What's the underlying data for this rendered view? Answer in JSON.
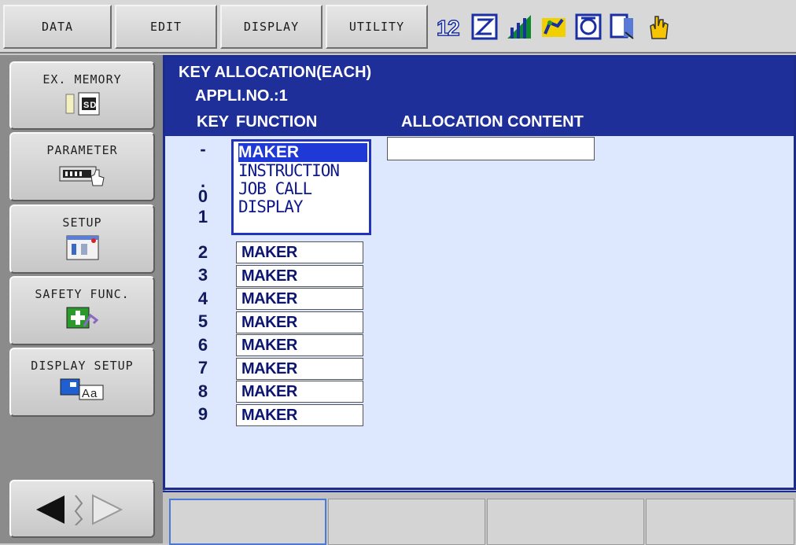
{
  "menu_bar": {
    "items": [
      {
        "label": "DATA"
      },
      {
        "label": "EDIT"
      },
      {
        "label": "DISPLAY"
      },
      {
        "label": "UTILITY"
      }
    ],
    "status_icons": [
      "numbers-12-icon",
      "edit-mode-icon",
      "signal-icon",
      "robot-arm-icon",
      "cycle-icon",
      "job-icon",
      "hand-icon"
    ]
  },
  "main_menu": {
    "items": [
      {
        "label": "EX. MEMORY",
        "icon": "sd-card-icon"
      },
      {
        "label": "PARAMETER",
        "icon": "parameter-icon"
      },
      {
        "label": "SETUP",
        "icon": "setup-icon"
      },
      {
        "label": "SAFETY FUNC.",
        "icon": "safety-icon"
      },
      {
        "label": "DISPLAY SETUP",
        "icon": "display-setup-icon"
      }
    ],
    "nav": [
      "arrow-left-icon",
      "divider-icon",
      "arrow-right-icon"
    ]
  },
  "screen": {
    "title": "KEY ALLOCATION(EACH)",
    "appli_no": "APPLI.NO.:1",
    "col_key": "KEY",
    "col_function": "FUNCTION",
    "col_alloc": "ALLOCATION CONTENT",
    "keys": [
      "-",
      ".",
      "0",
      "1",
      "2",
      "3",
      "4",
      "5",
      "6",
      "7",
      "8",
      "9"
    ],
    "functions": [
      "MAKER",
      "MAKER",
      "MAKER",
      "MAKER",
      "MAKER",
      "MAKER",
      "MAKER",
      "MAKER"
    ],
    "dropdown": {
      "options": [
        "MAKER",
        "INSTRUCTION",
        "JOB CALL",
        "DISPLAY"
      ],
      "selected": "MAKER"
    }
  },
  "colors": {
    "header_blue": "#1f2f99",
    "content_bg": "#dde8ff",
    "selection_blue": "#1f39d6"
  }
}
